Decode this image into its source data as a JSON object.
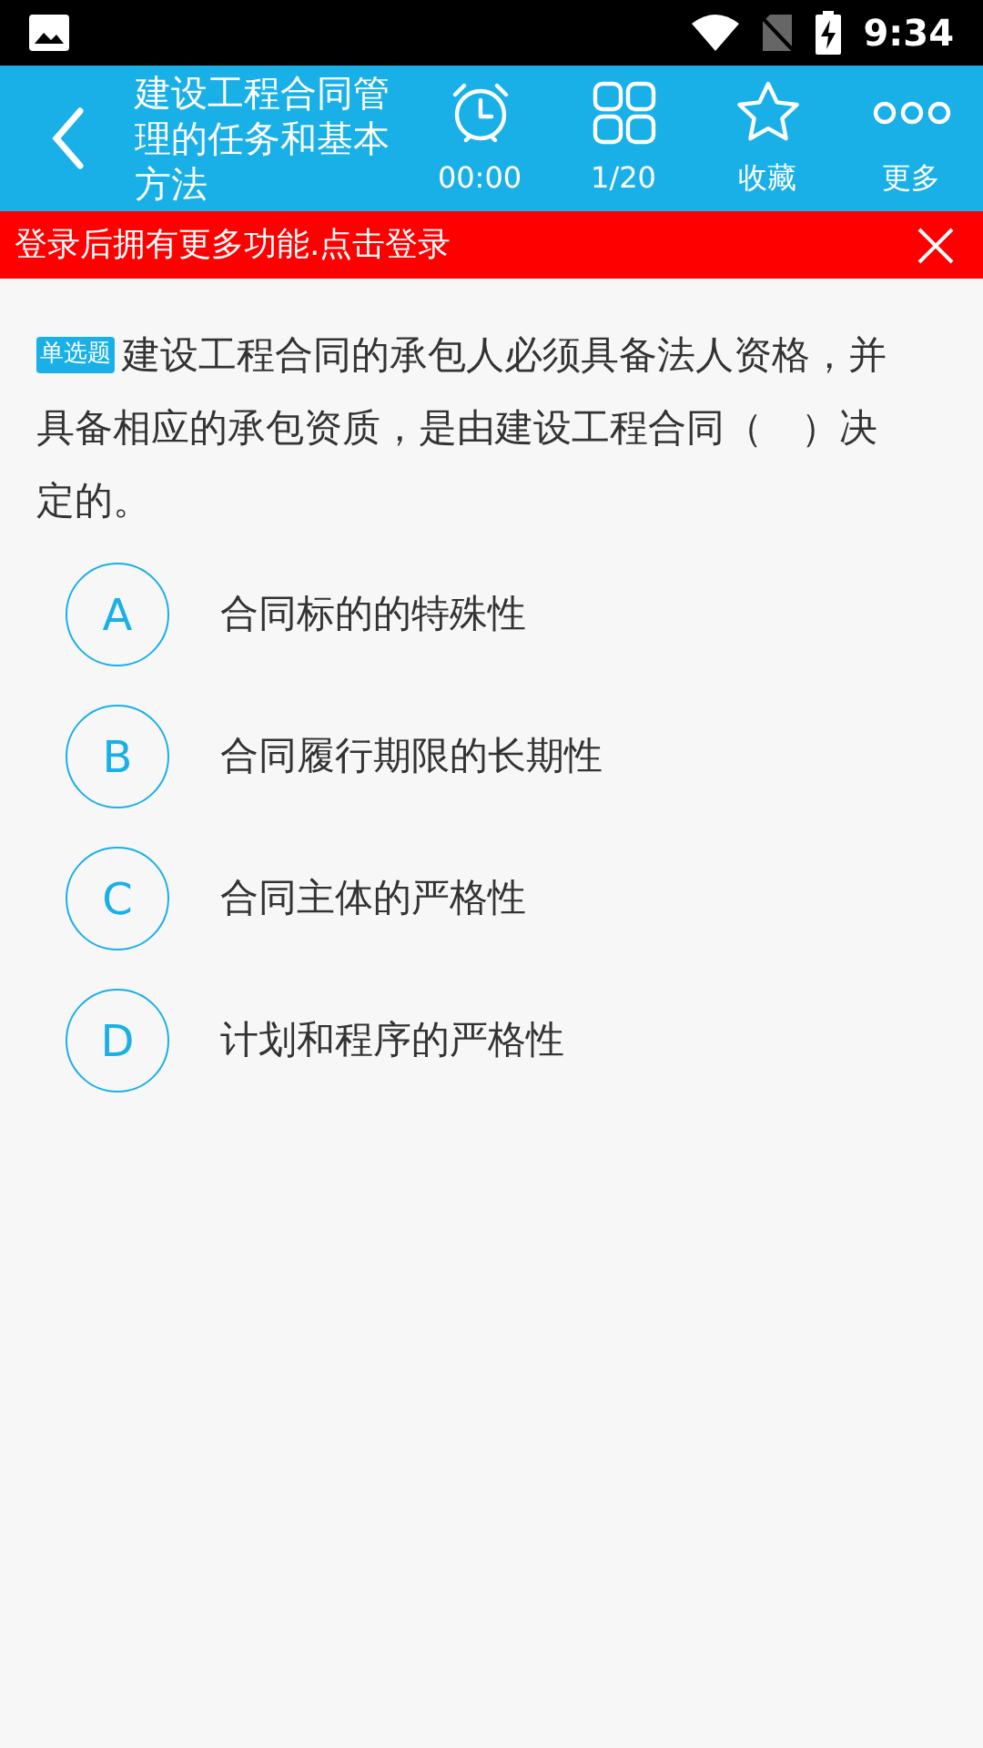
{
  "status_bar": {
    "time": "9:34"
  },
  "header": {
    "title": "建设工程合同管理的任务和基本方法",
    "actions": [
      {
        "kind": "timer",
        "label": "00:00"
      },
      {
        "kind": "grid",
        "label": "1/20"
      },
      {
        "kind": "star",
        "label": "收藏"
      },
      {
        "kind": "more",
        "label": "更多"
      }
    ]
  },
  "login_banner": {
    "text": "登录后拥有更多功能.点击登录"
  },
  "question": {
    "type_badge": "单选题",
    "text_lines": [
      "建设工程合同的承包人必须具备法人资格，并",
      "具备相应的承包资质，是由建设工程合同（　）决",
      "定的。"
    ]
  },
  "options": [
    {
      "letter": "A",
      "text": "合同标的的特殊性",
      "selected": false
    },
    {
      "letter": "B",
      "text": "合同履行期限的长期性",
      "selected": false
    },
    {
      "letter": "C",
      "text": "合同主体的严格性",
      "selected": false
    },
    {
      "letter": "D",
      "text": "计划和程序的严格性",
      "selected": false
    }
  ]
}
